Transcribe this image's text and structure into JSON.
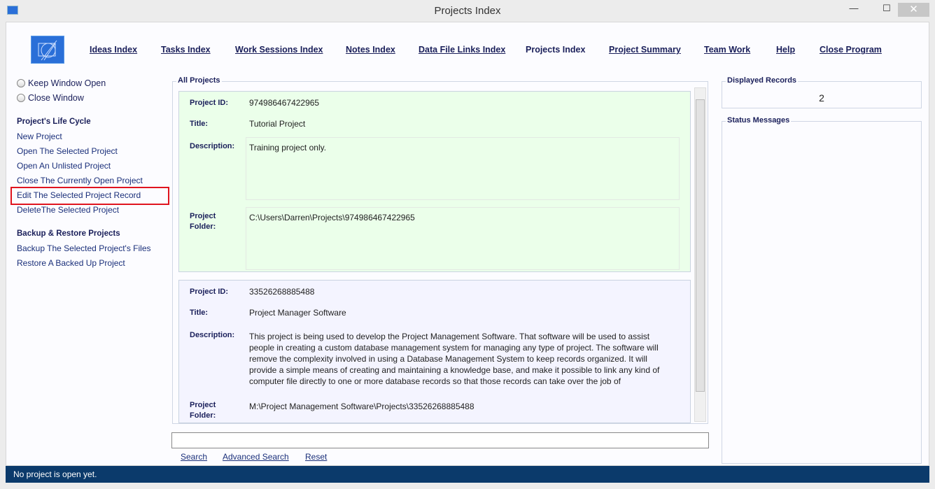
{
  "window": {
    "title": "Projects Index",
    "minimize": "—",
    "maximize": "☐",
    "close": "✕"
  },
  "nav": [
    "Ideas Index",
    "Tasks Index",
    "Work Sessions Index",
    "Notes Index",
    "Data File Links Index",
    "Projects Index",
    "Project Summary",
    "Team Work",
    "Help",
    "Close Program"
  ],
  "options": {
    "keep_open": "Keep Window Open",
    "close_window": "Close Window"
  },
  "lifecycle": {
    "heading": "Project's Life Cycle",
    "items": [
      "New Project",
      "Open The Selected Project",
      "Open An Unlisted Project",
      "Close The Currently Open Project",
      "Edit The Selected Project Record",
      "DeleteThe Selected Project"
    ]
  },
  "backup": {
    "heading": "Backup & Restore Projects",
    "items": [
      "Backup The Selected Project's Files",
      "Restore A Backed Up Project"
    ]
  },
  "all_projects": {
    "label": "All Projects",
    "field_labels": {
      "id": "Project ID:",
      "title": "Title:",
      "description": "Description:",
      "folder1": "Project",
      "folder2": "Folder:"
    },
    "projects": [
      {
        "id": "974986467422965",
        "title": "Tutorial Project",
        "description": "Training project only.",
        "folder": "C:\\Users\\Darren\\Projects\\974986467422965"
      },
      {
        "id": "33526268885488",
        "title": "Project Manager Software",
        "description": "This project is being used to develop the Project Management Software. That software will be used to assist people in creating a custom database management system for managing any type of project. The software will remove the complexity involved in using a Database Management System to keep records organized. It will provide a simple means of creating and maintaining a knowledge base, and make it possible to link any kind of computer file directly to one or more database records so that those records can take over the job of",
        "folder": "M:\\Project Management Software\\Projects\\33526268885488"
      }
    ]
  },
  "search": {
    "value": "",
    "search": "Search",
    "advanced": "Advanced Search",
    "reset": "Reset"
  },
  "displayed": {
    "label": "Displayed Records",
    "value": "2"
  },
  "status_messages": {
    "label": "Status Messages"
  },
  "statusbar": "No project is open yet."
}
